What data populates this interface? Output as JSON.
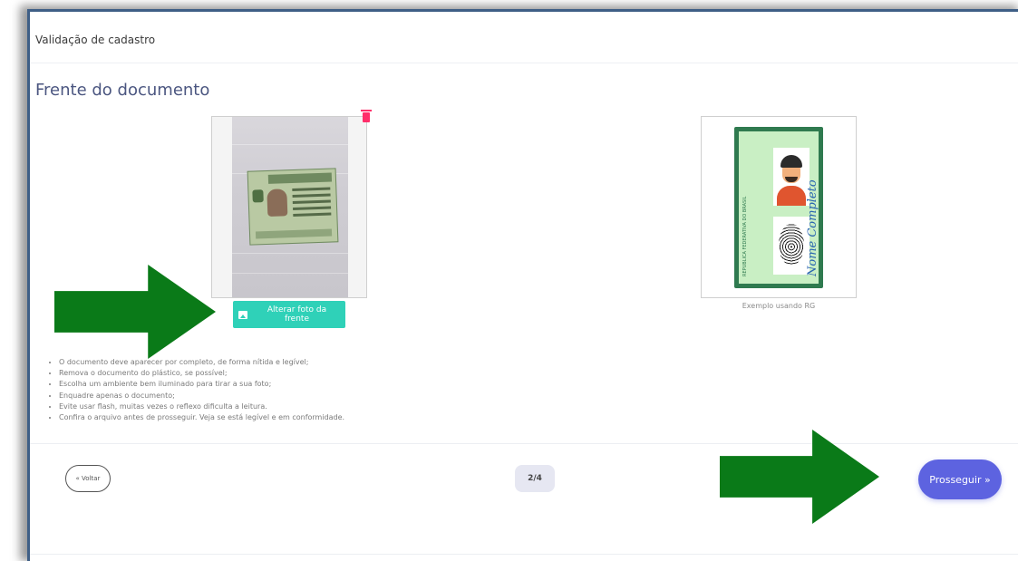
{
  "header": {
    "title": "Validação de cadastro"
  },
  "section": {
    "title": "Frente do documento"
  },
  "upload": {
    "change_button_label": "Alterar foto da frente"
  },
  "example": {
    "caption": "Exemplo usando RG",
    "name_text": "Nome Completo",
    "stripe_text": "REPUBLICA FEDERATIVA DO BRASIL"
  },
  "instructions": [
    "O documento deve aparecer por completo, de forma nítida e legível;",
    "Remova o documento do plástico, se possível;",
    "Escolha um ambiente bem iluminado para tirar a sua foto;",
    "Enquadre apenas o documento;",
    "Evite usar flash, muitas vezes o reflexo dificulta a leitura.",
    "Confira o arquivo antes de prosseguir. Veja se está legível e em conformidade."
  ],
  "navigation": {
    "back_label": "« Voltar",
    "page_indicator": "2/4",
    "next_label": "Prosseguir »"
  },
  "colors": {
    "accent_teal": "#2fd1b8",
    "primary_button": "#5d63e0",
    "annotation_arrow": "#0a7a18",
    "delete_icon": "#ff2e6a"
  },
  "icons": [
    "trash-icon",
    "image-icon"
  ]
}
